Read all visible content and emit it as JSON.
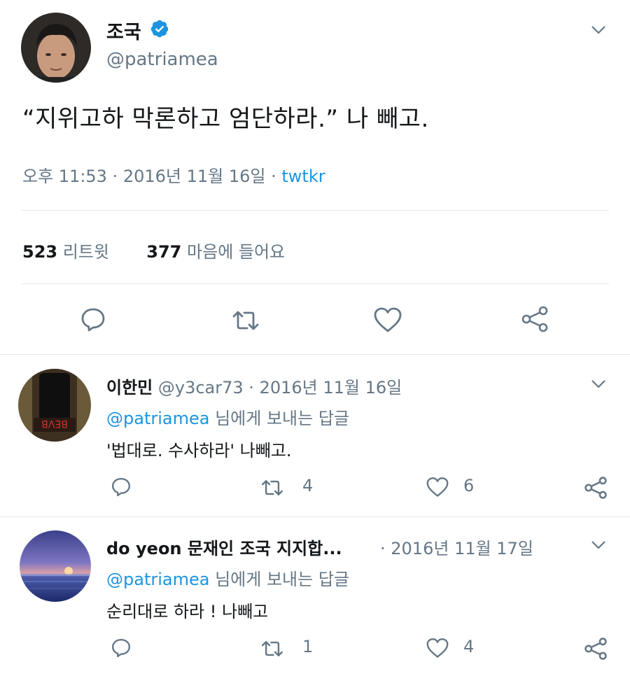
{
  "main_tweet": {
    "name": "조국",
    "handle": "@patriamea",
    "text": "“지위고하 막론하고 엄단하라.” 나 빼고.",
    "time": "오후 11:53 · 2016년 11월 16일 · ",
    "source": "twtkr",
    "retweets": {
      "count": "523",
      "label": "리트윗"
    },
    "likes": {
      "count": "377",
      "label": "마음에 들어요"
    },
    "actions": [
      "reply-icon",
      "retweet-icon",
      "heart-icon",
      "share-icon"
    ]
  },
  "replies": [
    {
      "name": "이한민",
      "handle_date": " @y3car73 · 2016년 11월 16일",
      "reply_to_handle": "@patriamea",
      "reply_to_suffix": " 님에게 보내는 답글",
      "text": "'법대로. 수사하라' 나빼고.",
      "retweets": "4",
      "likes": "6"
    },
    {
      "name": "do yeon 문재인 조국 지지합...",
      "handle_date": "· 2016년 11월 17일",
      "reply_to_handle": "@patriamea",
      "reply_to_suffix": " 님에게 보내는 답글",
      "text": "순리대로 하라 ! 나빼고",
      "retweets": "1",
      "likes": "4"
    }
  ],
  "colors": {
    "accent": "#1b95e0",
    "muted": "#657786",
    "text": "#14171a",
    "divider": "#e1e8ed"
  }
}
